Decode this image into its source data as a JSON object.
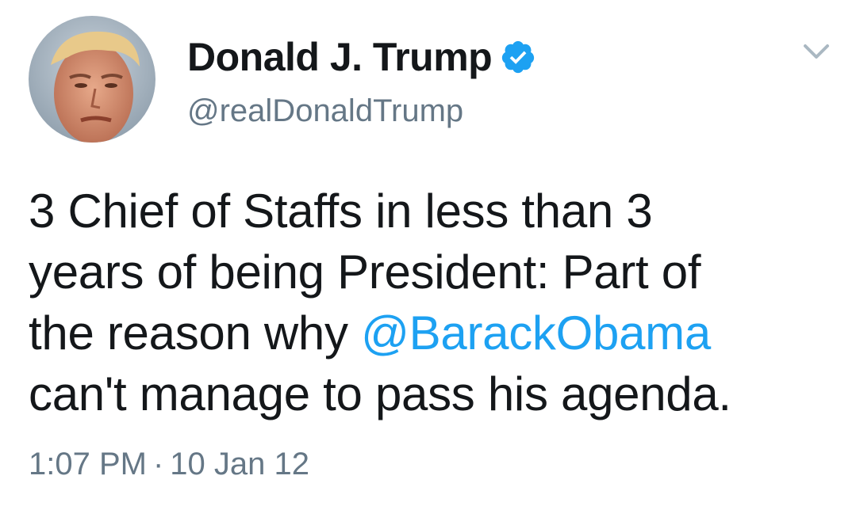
{
  "author": {
    "display_name": "Donald J. Trump",
    "handle": "@realDonaldTrump",
    "verified": true,
    "avatar_icon": "profile-photo-icon"
  },
  "menu": {
    "icon": "chevron-down-icon"
  },
  "tweet": {
    "lines": [
      "3 Chief of Staffs in less than 3",
      "years of being President: Part of"
    ],
    "line3_prefix": "the reason why ",
    "mention": "@BarackObama",
    "line4": "can't manage to pass his agenda."
  },
  "meta": {
    "time": "1:07 PM",
    "separator": "·",
    "date": "10 Jan 12"
  },
  "colors": {
    "text": "#14171a",
    "secondary": "#657786",
    "link": "#1da1f2",
    "verified": "#1da1f2"
  }
}
